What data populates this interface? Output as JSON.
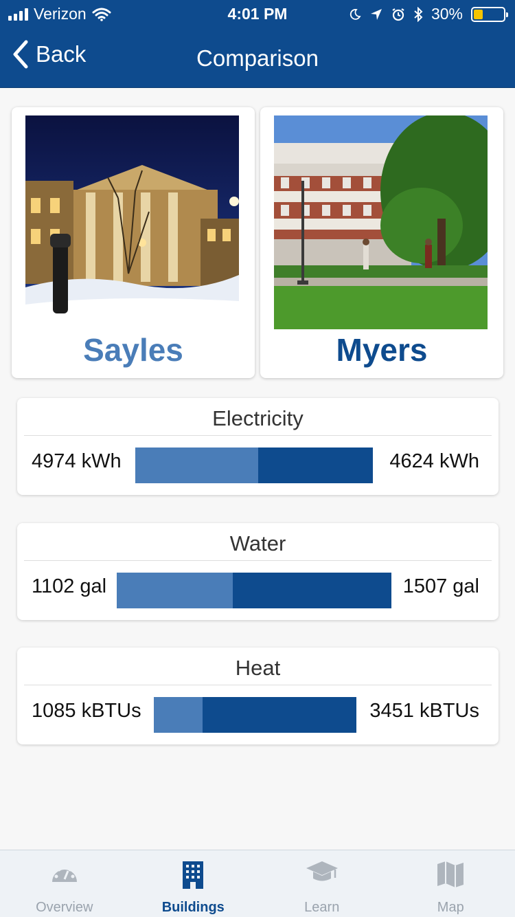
{
  "status_bar": {
    "carrier": "Verizon",
    "time": "4:01 PM",
    "battery": "30%",
    "battery_level": 0.3,
    "icons": [
      "signal-icon",
      "wifi-icon",
      "moon-icon",
      "location-arrow-icon",
      "alarm-icon",
      "bluetooth-icon",
      "battery-icon"
    ]
  },
  "nav": {
    "back_label": "Back",
    "title": "Comparison"
  },
  "buildings": [
    {
      "name": "Sayles",
      "color": "#4a7db8"
    },
    {
      "name": "Myers",
      "color": "#0e4b8e"
    }
  ],
  "metrics": [
    {
      "title": "Electricity",
      "left_value": "4974 kWh",
      "right_value": "4624 kWh",
      "left_amount": 4974,
      "right_amount": 4624
    },
    {
      "title": "Water",
      "left_value": "1102 gal",
      "right_value": "1507 gal",
      "left_amount": 1102,
      "right_amount": 1507
    },
    {
      "title": "Heat",
      "left_value": "1085 kBTUs",
      "right_value": "3451 kBTUs",
      "left_amount": 1085,
      "right_amount": 3451
    }
  ],
  "colors": {
    "primary": "#0e4b8e",
    "secondary": "#4a7db8",
    "inactive": "#9aa3ad"
  },
  "tabs": [
    {
      "label": "Overview",
      "icon": "dashboard-gauge-icon",
      "active": false
    },
    {
      "label": "Buildings",
      "icon": "building-icon",
      "active": true
    },
    {
      "label": "Learn",
      "icon": "graduation-cap-icon",
      "active": false
    },
    {
      "label": "Map",
      "icon": "map-icon",
      "active": false
    }
  ]
}
